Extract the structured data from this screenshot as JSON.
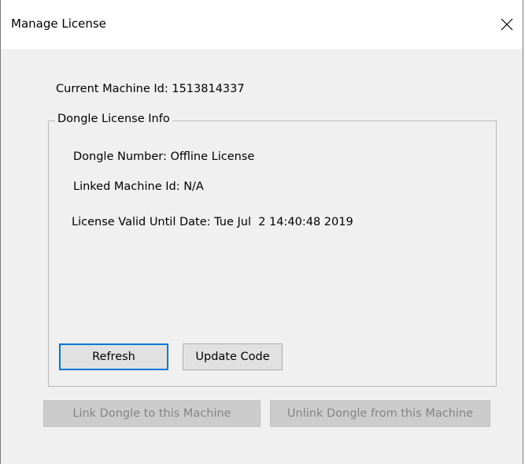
{
  "window": {
    "title": "Manage License"
  },
  "machine": {
    "current_id_text": "Current Machine Id: 1513814337"
  },
  "dongle_group": {
    "legend": "Dongle License Info",
    "dongle_number_text": "Dongle Number: Offline License",
    "linked_machine_text": "Linked Machine Id: N/A",
    "valid_until_text": "License Valid Until Date: Tue Jul  2 14:40:48 2019",
    "refresh_label": "Refresh",
    "update_code_label": "Update Code"
  },
  "actions": {
    "link_label": "Link Dongle to this Machine",
    "unlink_label": "Unlink Dongle from this Machine"
  },
  "icons": {
    "close": "close-icon"
  }
}
